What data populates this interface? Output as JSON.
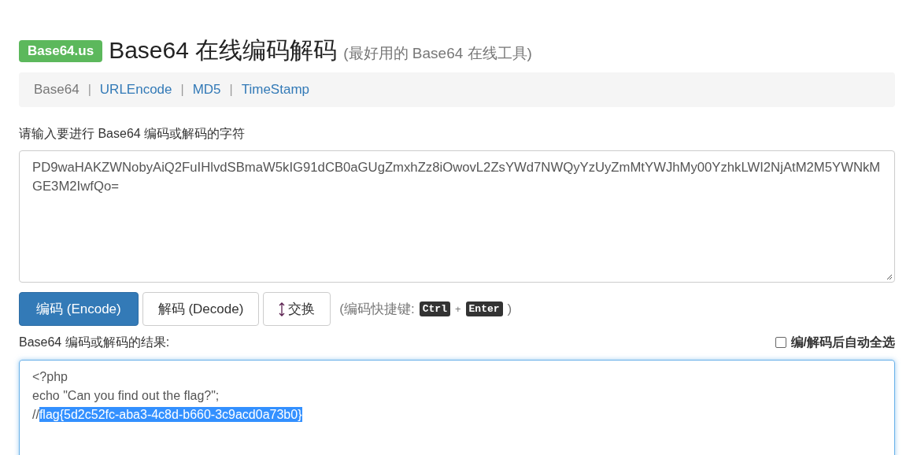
{
  "header": {
    "badge": "Base64.us",
    "title": "Base64 在线编码解码",
    "subtitle": "(最好用的 Base64 在线工具)"
  },
  "nav": {
    "separator": "|",
    "items": [
      {
        "label": "Base64",
        "selected": true
      },
      {
        "label": "URLEncode",
        "selected": false
      },
      {
        "label": "MD5",
        "selected": false
      },
      {
        "label": "TimeStamp",
        "selected": false
      }
    ]
  },
  "input": {
    "label": "请输入要进行 Base64 编码或解码的字符",
    "value": "PD9waHAKZWNobyAiQ2FuIHlvdSBmaW5kIG91dCB0aGUgZmxhZz8iOwovL2ZsYWd7NWQyYzUyZmMtYWJhMy00YzhkLWI2NjAtM2M5YWNkMGE3M2IwfQo="
  },
  "buttons": [
    {
      "label": "编码 (Encode)",
      "kind": "primary"
    },
    {
      "label": "解码 (Decode)",
      "kind": "default"
    },
    {
      "label": "交换",
      "kind": "swap"
    }
  ],
  "shortcut": {
    "prefix": "(编码快捷键:",
    "keys": [
      "Ctrl",
      "Enter"
    ],
    "joiner": "+",
    "suffix": ")"
  },
  "output": {
    "label": "Base64 编码或解码的结果:",
    "auto_select": {
      "label": "编/解码后自动全选",
      "checked": false
    },
    "lines": [
      [
        {
          "text": "<?php",
          "selected": false
        }
      ],
      [
        {
          "text": "echo \"Can you find out the flag?\";",
          "selected": false
        }
      ],
      [
        {
          "text": "//",
          "selected": false
        },
        {
          "text": "flag{5d2c52fc-aba3-4c8d-b660-3c9acd0a73b0}",
          "selected": true
        }
      ]
    ]
  }
}
